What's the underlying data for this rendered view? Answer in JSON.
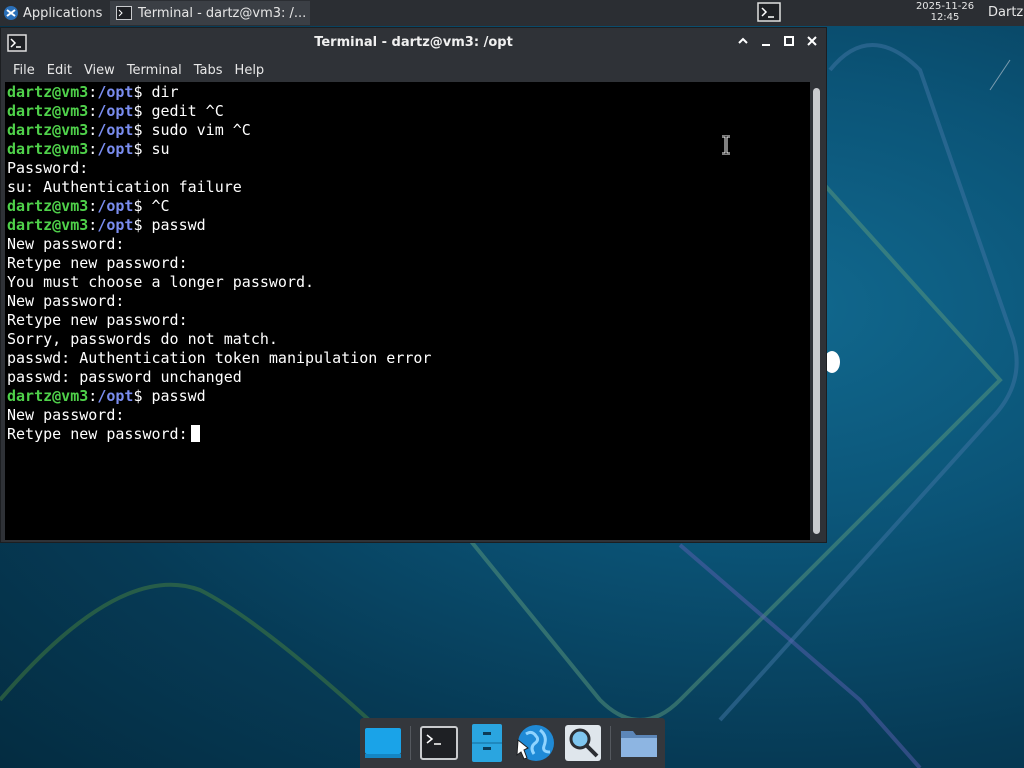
{
  "panel": {
    "applications_label": "Applications",
    "task_label": "Terminal - dartz@vm3: /...",
    "clock_date": "2025-11-26",
    "clock_time": "12:45",
    "user": "Dartz"
  },
  "window": {
    "title": "Terminal - dartz@vm3: /opt",
    "menu": [
      "File",
      "Edit",
      "View",
      "Terminal",
      "Tabs",
      "Help"
    ]
  },
  "terminal": {
    "prompt_user": "dartz@vm3",
    "prompt_sep": ":",
    "prompt_path": "/opt",
    "prompt_symbol": "$ ",
    "lines": [
      {
        "type": "cmd",
        "text": "dir"
      },
      {
        "type": "cmd",
        "text": "gedit ^C"
      },
      {
        "type": "cmd",
        "text": "sudo vim ^C"
      },
      {
        "type": "cmd",
        "text": "su"
      },
      {
        "type": "out",
        "text": "Password:"
      },
      {
        "type": "out",
        "text": "su: Authentication failure"
      },
      {
        "type": "cmd",
        "text": "^C"
      },
      {
        "type": "cmd",
        "text": "passwd"
      },
      {
        "type": "out",
        "text": "New password:"
      },
      {
        "type": "out",
        "text": "Retype new password:"
      },
      {
        "type": "out",
        "text": "You must choose a longer password."
      },
      {
        "type": "out",
        "text": "New password:"
      },
      {
        "type": "out",
        "text": "Retype new password:"
      },
      {
        "type": "out",
        "text": "Sorry, passwords do not match."
      },
      {
        "type": "out",
        "text": "passwd: Authentication token manipulation error"
      },
      {
        "type": "out",
        "text": "passwd: password unchanged"
      },
      {
        "type": "cmd",
        "text": "passwd"
      },
      {
        "type": "out",
        "text": "New password:"
      },
      {
        "type": "active",
        "text": "Retype new password: "
      }
    ]
  },
  "dock": {
    "items": [
      "show-desktop-icon",
      "terminal-icon",
      "file-manager-icon",
      "web-browser-icon",
      "app-finder-icon",
      "folder-icon"
    ]
  },
  "colors": {
    "prompt_user": "#4fd14a",
    "prompt_path": "#7a8df0",
    "terminal_bg": "#000000",
    "panel_bg": "#2b2e33"
  }
}
